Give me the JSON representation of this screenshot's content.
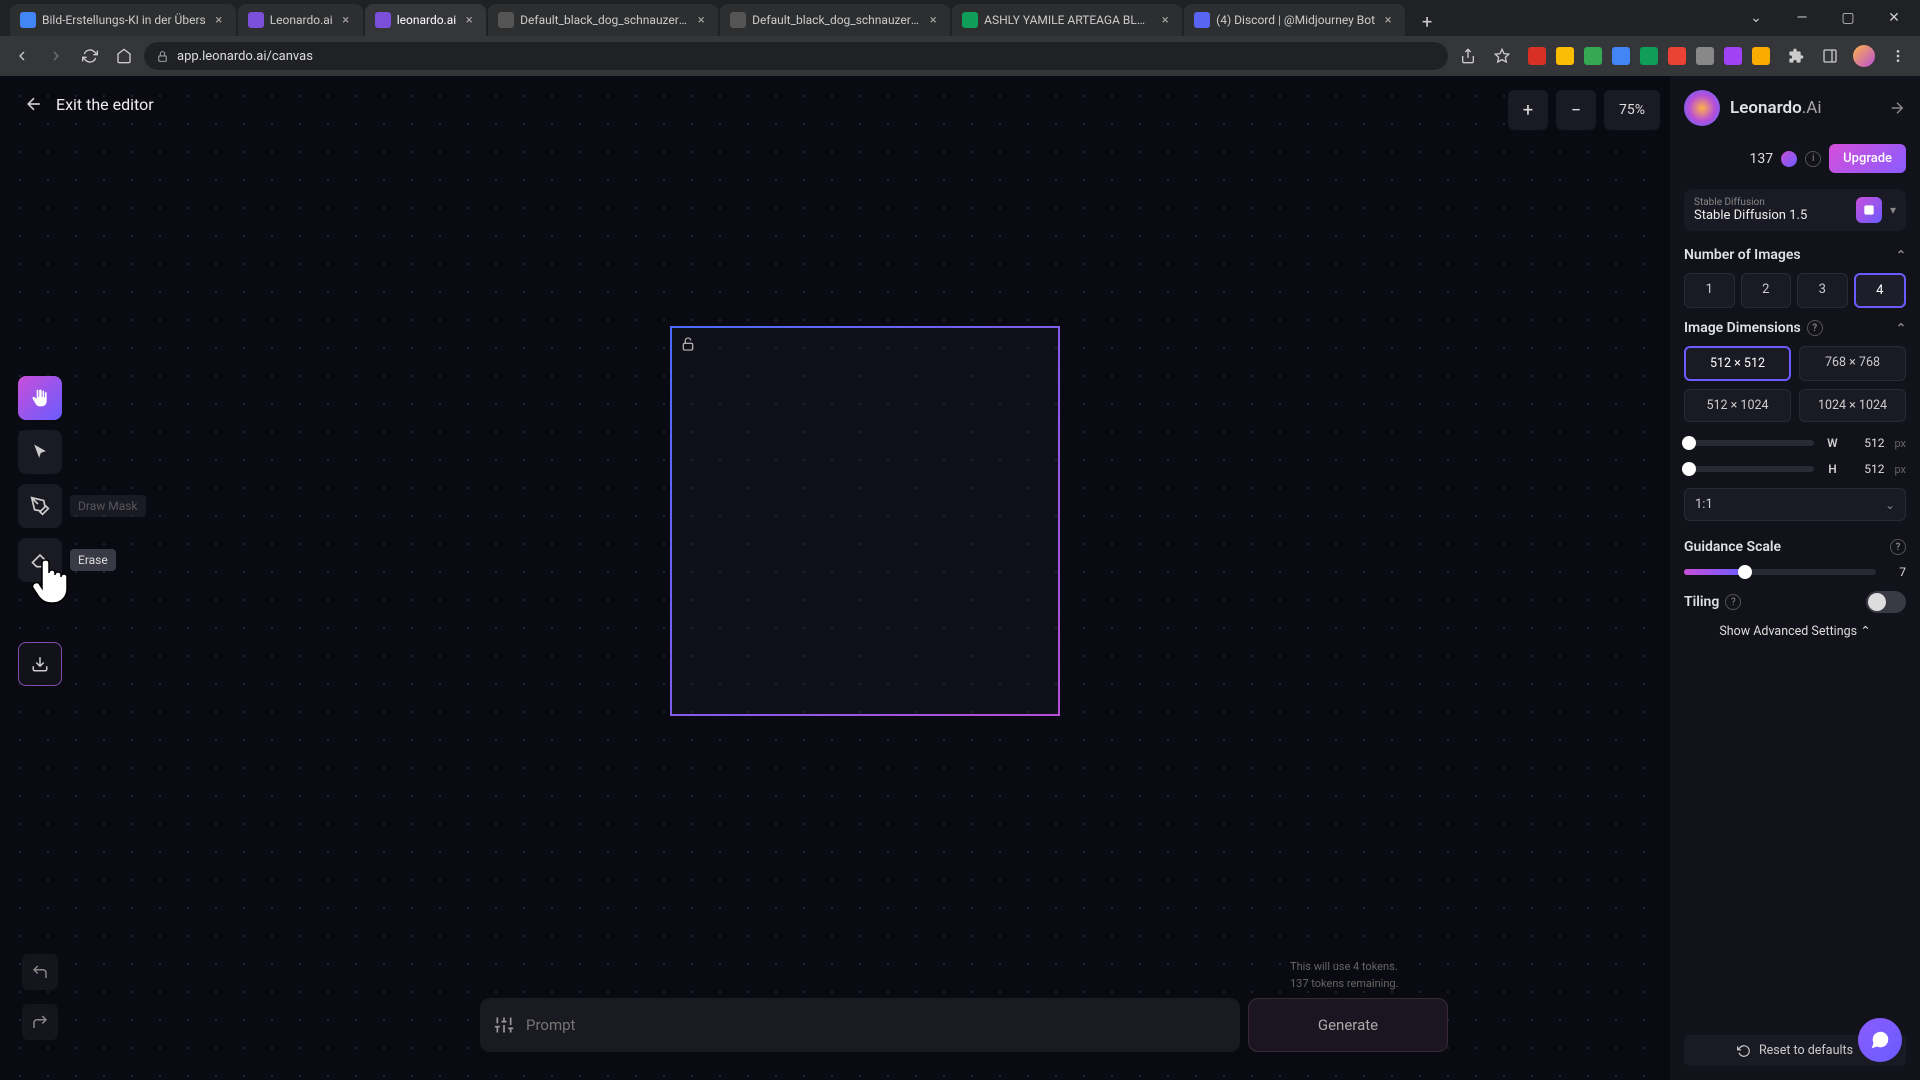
{
  "browser": {
    "tabs": [
      {
        "title": "Bild-Erstellungs-KI in der Übers",
        "favicon": "#4285f4"
      },
      {
        "title": "Leonardo.ai",
        "favicon": "#7b4fd9"
      },
      {
        "title": "leonardo.ai",
        "favicon": "#7b4fd9",
        "active": true
      },
      {
        "title": "Default_black_dog_schnauzer_f",
        "favicon": "#555555"
      },
      {
        "title": "Default_black_dog_schnauzer_f",
        "favicon": "#555555"
      },
      {
        "title": "ASHLY YAMILE ARTEAGA BLAN",
        "favicon": "#0f9d58"
      },
      {
        "title": "(4) Discord | @Midjourney Bot",
        "favicon": "#5865f2"
      }
    ],
    "url": "app.leonardo.ai/canvas"
  },
  "editor": {
    "exit_label": "Exit the editor",
    "zoom": "75%",
    "tooltip_erase": "Erase",
    "tooltip_mask": "Draw Mask"
  },
  "tokens": {
    "count": "137",
    "use_line": "This will use 4 tokens.",
    "remain_line": "137 tokens remaining."
  },
  "brand": {
    "name": "Leonardo",
    "suffix": ".Ai"
  },
  "upgrade_label": "Upgrade",
  "model": {
    "small": "Stable Diffusion",
    "name": "Stable Diffusion 1.5"
  },
  "num_images": {
    "label": "Number of Images",
    "options": [
      "1",
      "2",
      "3",
      "4"
    ],
    "selected": "4"
  },
  "dimensions": {
    "label": "Image Dimensions",
    "presets": [
      "512 × 512",
      "768 × 768",
      "512 × 1024",
      "1024 × 1024"
    ],
    "selected": "512 × 512",
    "w_label": "W",
    "w_value": "512",
    "px": "px",
    "h_label": "H",
    "h_value": "512",
    "aspect": "1:1"
  },
  "guidance": {
    "label": "Guidance Scale",
    "value": "7"
  },
  "tiling": {
    "label": "Tiling"
  },
  "adv_label": "Show Advanced Settings",
  "reset_label": "Reset to defaults",
  "prompt": {
    "placeholder": "Prompt"
  },
  "generate_label": "Generate"
}
